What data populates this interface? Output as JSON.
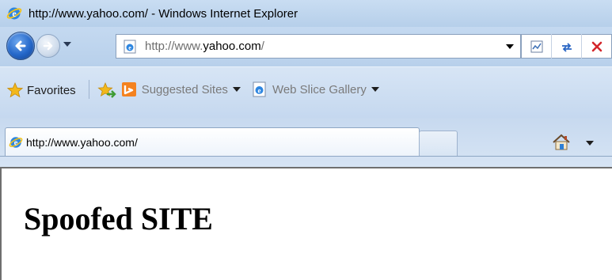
{
  "window": {
    "title": "http://www.yahoo.com/ - Windows Internet Explorer"
  },
  "navigation": {
    "back_icon": "back-arrow-icon",
    "forward_icon": "forward-arrow-icon",
    "address": {
      "url_prefix": "http://www.",
      "url_domain": "yahoo.com",
      "url_suffix": "/"
    },
    "tools": [
      "compatibility-view-icon",
      "refresh-icon",
      "stop-icon"
    ]
  },
  "favorites_bar": {
    "favorites_label": "Favorites",
    "suggested_sites_label": "Suggested Sites",
    "web_slice_gallery_label": "Web Slice Gallery"
  },
  "tabs": {
    "active_tab_title": "http://www.yahoo.com/",
    "home_icon": "home-icon"
  },
  "page": {
    "heading": "Spoofed SITE"
  },
  "colors": {
    "chrome_blue": "#c4d9f0",
    "stop_red": "#d3262b",
    "favorites_star": "#f2b81c",
    "suggested_orange": "#f4821f"
  }
}
